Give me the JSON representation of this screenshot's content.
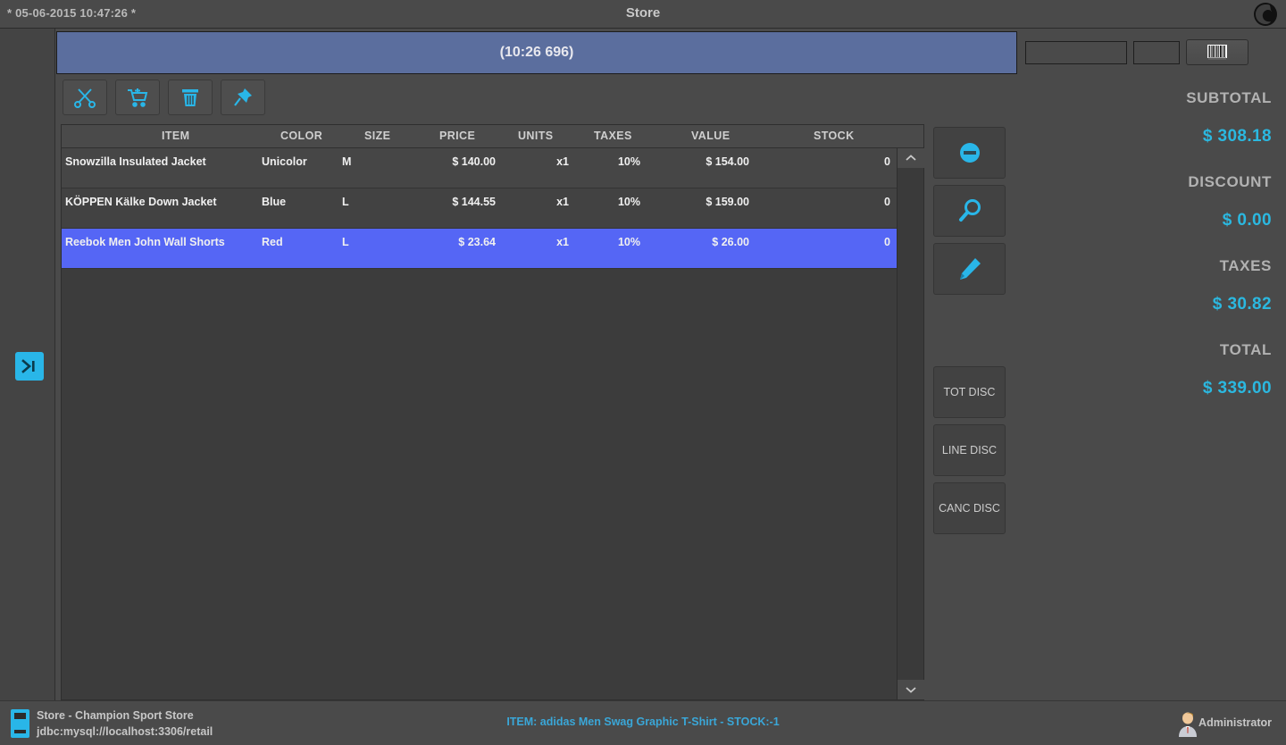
{
  "titlebar": {
    "datetime": "* 05-06-2015 10:47:26  *",
    "title": "Store",
    "logo_icon": "app-logo-icon"
  },
  "left_rail": {
    "expand_button_icon": "expand-panel-icon"
  },
  "ticket": {
    "header_label": "(10:26 696)"
  },
  "topright": {
    "code_field_value": "",
    "code_field_placeholder": "",
    "qty_field_value": "",
    "qty_field_placeholder": "",
    "barcode_button_icon": "barcode-icon"
  },
  "toolbar": {
    "buttons": [
      {
        "name": "cut-line-button",
        "icon": "scissors-icon"
      },
      {
        "name": "add-to-cart-button",
        "icon": "shopping-cart-icon"
      },
      {
        "name": "delete-ticket-button",
        "icon": "trash-icon"
      },
      {
        "name": "pin-button",
        "icon": "pushpin-icon"
      }
    ]
  },
  "table": {
    "columns": [
      "ITEM",
      "COLOR",
      "SIZE",
      "PRICE",
      "UNITS",
      "TAXES",
      "VALUE",
      "STOCK"
    ],
    "rows": [
      {
        "item": "Snowzilla Insulated Jacket",
        "color": "Unicolor",
        "size": "M",
        "price": "$ 140.00",
        "units": "x1",
        "taxes": "10%",
        "value": "$ 154.00",
        "stock": "0",
        "selected": false
      },
      {
        "item": "KÖPPEN Kälke Down Jacket",
        "color": "Blue",
        "size": "L",
        "price": "$ 144.55",
        "units": "x1",
        "taxes": "10%",
        "value": "$ 159.00",
        "stock": "0",
        "selected": false
      },
      {
        "item": "Reebok Men John Wall Shorts",
        "color": "Red",
        "size": "L",
        "price": "$ 23.64",
        "units": "x1",
        "taxes": "10%",
        "value": "$ 26.00",
        "stock": "0",
        "selected": true
      }
    ],
    "scroll_up_icon": "chevron-up-icon",
    "scroll_down_icon": "chevron-down-icon"
  },
  "actions": {
    "remove_icon": "minus-circle-icon",
    "search_icon": "magnifier-icon",
    "edit_icon": "pencil-icon",
    "tot_disc_label": "TOT DISC",
    "line_disc_label": "LINE DISC",
    "canc_disc_label": "CANC DISC"
  },
  "totals": {
    "subtotal_label": "SUBTOTAL",
    "subtotal_value": "$ 308.18",
    "discount_label": "DISCOUNT",
    "discount_value": "$ 0.00",
    "taxes_label": "TAXES",
    "taxes_value": "$ 30.82",
    "total_label": "TOTAL",
    "total_value": "$ 339.00"
  },
  "statusbar": {
    "store_name": "Store - Champion Sport Store",
    "db_url": "jdbc:mysql://localhost:3306/retail",
    "message": "ITEM: adidas Men Swag Graphic T-Shirt  -  STOCK:-1",
    "user": "Administrator",
    "db_icon": "database-icon",
    "user_icon": "user-avatar-icon"
  },
  "colors": {
    "accent_cyan": "#29b6e8",
    "selection_blue": "#5566f5",
    "header_blue": "#5b6e9e",
    "window_bg": "#4a4a4a",
    "total_text": "#2bb8e0"
  }
}
